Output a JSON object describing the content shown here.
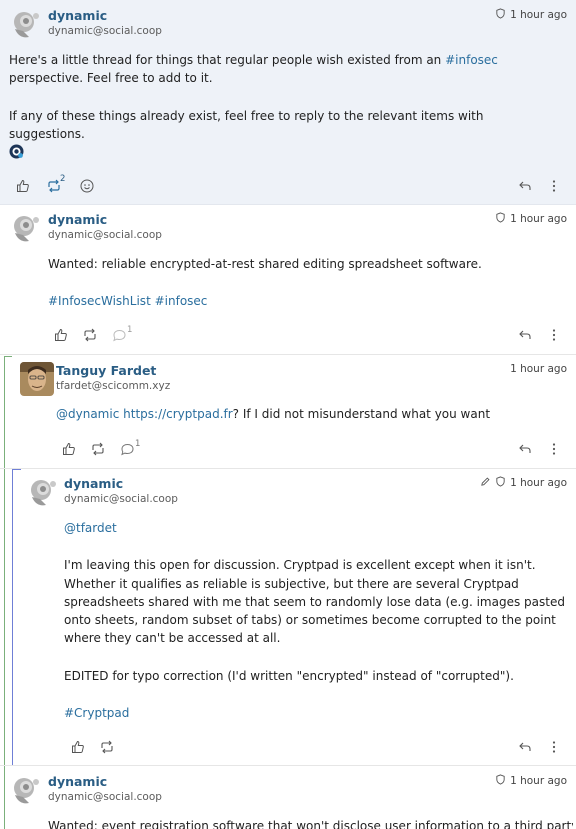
{
  "posts": [
    {
      "name": "dynamic",
      "handle": "dynamic@social.coop",
      "time": "1 hour ago",
      "paragraphs": [
        {
          "pre": "Here's a little thread for things that regular people wish existed from an ",
          "link": "#infosec",
          "post": " perspective. Feel free to add to it."
        },
        {
          "text": "If any of these things already exist, feel free to reply to the relevant items with suggestions."
        }
      ],
      "reaction_emoji": "custom-emoji-icon",
      "boost_count": "2"
    },
    {
      "name": "dynamic",
      "handle": "dynamic@social.coop",
      "time": "1 hour ago",
      "text": "Wanted: reliable encrypted-at-rest shared editing spreadsheet software.",
      "tags": [
        "#InfosecWishList",
        "#infosec"
      ],
      "reply_count": "1"
    },
    {
      "name": "Tanguy Fardet",
      "handle": "tfardet@scicomm.xyz",
      "time": "1 hour ago",
      "mention": "@dynamic",
      "url": "https://cryptpad.fr",
      "rest": "? If I did not misunderstand what you want",
      "reply_count": "1"
    },
    {
      "name": "dynamic",
      "handle": "dynamic@social.coop",
      "time": "1 hour ago",
      "mention": "@tfardet",
      "paragraphs": [
        "I'm leaving this open for discussion. Cryptpad is excellent except when it isn't. Whether it qualifies as reliable is subjective, but there are several Cryptpad spreadsheets shared with me that seem to randomly lose data (e.g. images pasted onto sheets, random subset of tabs) or sometimes become corrupted to the point where they can't be accessed at all.",
        "EDITED for typo correction (I'd written \"encrypted\" instead of \"corrupted\")."
      ],
      "tag": "#Cryptpad"
    },
    {
      "name": "dynamic",
      "handle": "dynamic@social.coop",
      "time": "1 hour ago",
      "text": "Wanted: event registration software that won't disclose user information to a third party"
    }
  ],
  "colors": {
    "name": "#2a5d84",
    "link": "#2a6e9e",
    "first_post_bg": "#eef2f8",
    "thread_line_green": "#7bb07b",
    "thread_line_blue": "#6f7fd6"
  }
}
